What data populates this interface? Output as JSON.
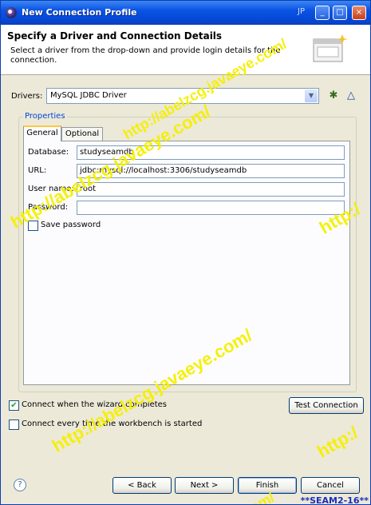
{
  "window": {
    "title": "New Connection Profile",
    "ime_indicator": "JP",
    "controls": {
      "minimize": "_",
      "maximize": "□",
      "close": "×"
    }
  },
  "header": {
    "title": "Specify a Driver and Connection Details",
    "description": "Select a driver from the drop-down and provide login details for the connection."
  },
  "drivers": {
    "label": "Drivers:",
    "selected": "MySQL JDBC Driver",
    "new_icon": "new-driver-icon",
    "edit_icon": "edit-driver-icon"
  },
  "properties": {
    "group_label": "Properties",
    "tabs": [
      {
        "label": "General",
        "active": true
      },
      {
        "label": "Optional",
        "active": false
      }
    ],
    "fields": {
      "database": {
        "label": "Database:",
        "value": "studyseamdb"
      },
      "url": {
        "label": "URL:",
        "value": "jdbc:mysql://localhost:3306/studyseamdb"
      },
      "username": {
        "label": "User name:",
        "value": "root"
      },
      "password": {
        "label": "Password:",
        "value": ""
      }
    },
    "save_password": {
      "label": "Save password",
      "checked": false
    }
  },
  "options": {
    "connect_when_complete": {
      "label": "Connect when the wizard completes",
      "checked": true
    },
    "connect_every_time": {
      "label": "Connect every time the workbench is started",
      "checked": false
    }
  },
  "buttons": {
    "test_connection": "Test Connection",
    "back": "< Back",
    "next": "Next >",
    "finish": "Finish",
    "cancel": "Cancel",
    "help": "?"
  },
  "watermarks": {
    "text": "http://abelzcg.javaeye.com/",
    "fragment": "http:/",
    "tail": "com/"
  },
  "footer_tag": "**SEAM2-16**",
  "colors": {
    "accent": "#0a54e3",
    "watermark": "#f5f000",
    "tag": "#1a2dbf"
  }
}
